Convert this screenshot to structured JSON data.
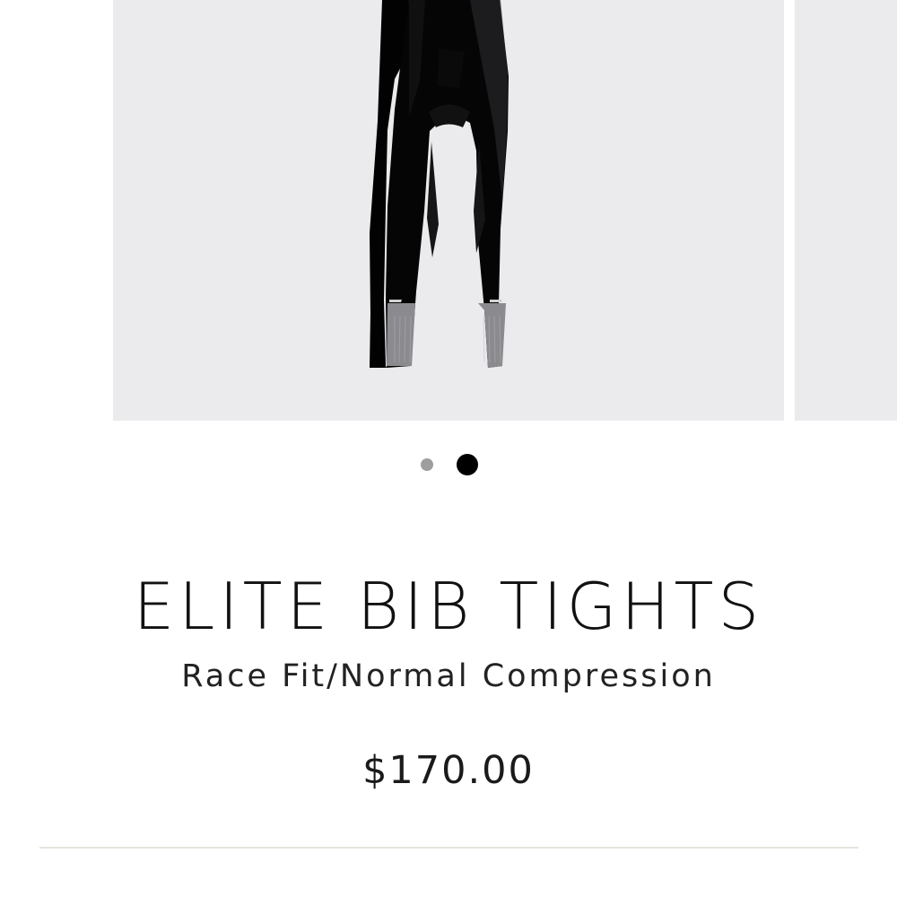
{
  "product": {
    "title": "ELITE BIB TIGHTS",
    "subtitle": "Race Fit/Normal Compression",
    "price": "$170.00"
  },
  "gallery": {
    "slide_count": 2,
    "active_slide": 2,
    "zoom_icon": "search-icon",
    "colors": {
      "background": "#ebebed",
      "product": "#000000",
      "reflective_panel": "#8a8a8f"
    }
  },
  "colors": {
    "active_dot": "#000000",
    "inactive_dot": "#9e9e9e",
    "divider": "#e6e4dc"
  }
}
